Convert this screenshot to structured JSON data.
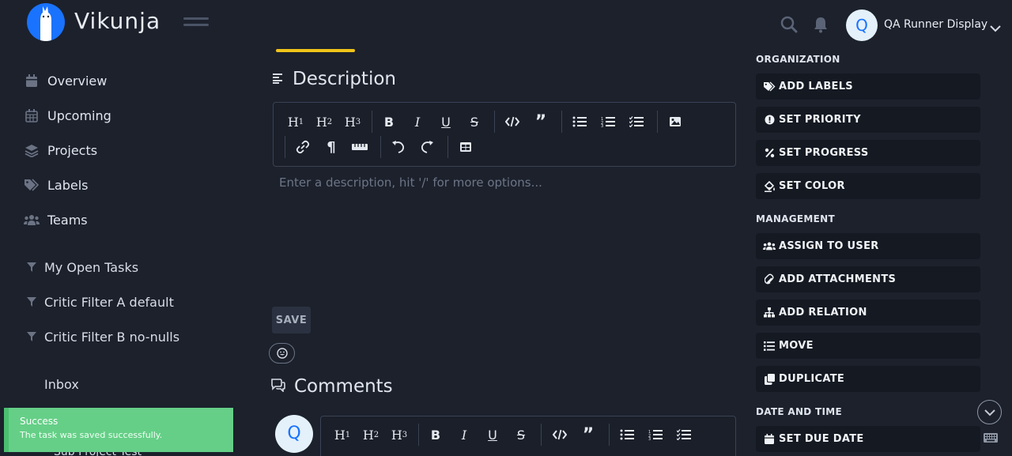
{
  "app": {
    "name": "Vikunja"
  },
  "header": {
    "user_name": "QA Runner Display",
    "avatar_initial": "Q"
  },
  "sidebar": {
    "items": [
      {
        "label": "Overview",
        "icon": "calendar-icon"
      },
      {
        "label": "Upcoming",
        "icon": "calendar-grid-icon"
      },
      {
        "label": "Projects",
        "icon": "layers-icon"
      },
      {
        "label": "Labels",
        "icon": "tags-icon"
      },
      {
        "label": "Teams",
        "icon": "users-icon"
      }
    ],
    "filters": [
      {
        "label": "My Open Tasks"
      },
      {
        "label": "Critic Filter A default"
      },
      {
        "label": "Critic Filter B no-nulls"
      }
    ],
    "inbox": "Inbox",
    "sub_project": "Sub Project Test"
  },
  "toast": {
    "title": "Success",
    "message": "The task was saved successfully."
  },
  "description": {
    "heading": "Description",
    "placeholder": "Enter a description, hit '/' for more options...",
    "save_label": "SAVE"
  },
  "comments": {
    "heading": "Comments",
    "avatar_initial": "Q"
  },
  "toolbar": {
    "h1": "H",
    "h2": "H",
    "h3": "H",
    "h1_sub": "1",
    "h2_sub": "2",
    "h3_sub": "3"
  },
  "right_panel": {
    "organization_heading": "ORGANIZATION",
    "organization": [
      {
        "label": "ADD LABELS",
        "icon": "tags-icon"
      },
      {
        "label": "SET PRIORITY",
        "icon": "exclamation-icon"
      },
      {
        "label": "SET PROGRESS",
        "icon": "percent-icon"
      },
      {
        "label": "SET COLOR",
        "icon": "fill-drip-icon"
      }
    ],
    "management_heading": "MANAGEMENT",
    "management": [
      {
        "label": "ASSIGN TO USER",
        "icon": "users-icon"
      },
      {
        "label": "ADD ATTACHMENTS",
        "icon": "paperclip-icon"
      },
      {
        "label": "ADD RELATION",
        "icon": "sitemap-icon"
      },
      {
        "label": "MOVE",
        "icon": "list-icon"
      },
      {
        "label": "DUPLICATE",
        "icon": "copy-icon"
      }
    ],
    "datetime_heading": "DATE AND TIME",
    "datetime": [
      {
        "label": "SET DUE DATE",
        "icon": "calendar-icon"
      }
    ]
  },
  "colors": {
    "background": "#1c212c",
    "accent": "#1973ff",
    "success": "#65cf87",
    "highlight": "#f0c419"
  }
}
